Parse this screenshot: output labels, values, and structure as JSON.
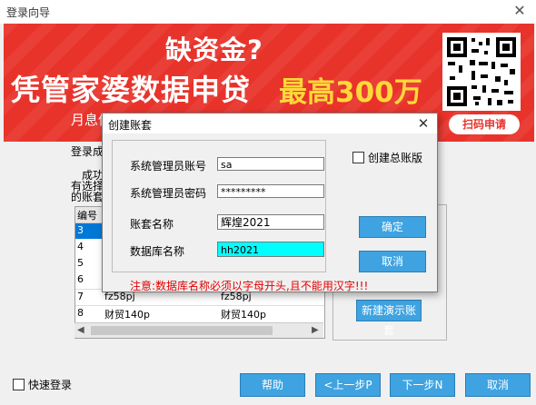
{
  "window": {
    "title": "登录向导",
    "close_glyph": "✕"
  },
  "banner": {
    "question": "缺资金?",
    "main": "凭管家婆数据申贷",
    "max": "最高300万",
    "sub": "月息低",
    "scan": "扫码申请",
    "accent": "#e8332b"
  },
  "background": {
    "line1": "登录成",
    "line2": "成功",
    "line3": "有选择",
    "line4": "的账套",
    "grid_header": {
      "col1": "编号"
    },
    "rows": [
      {
        "id": "3",
        "name": "",
        "name2": ""
      },
      {
        "id": "4",
        "name": "",
        "name2": ""
      },
      {
        "id": "5",
        "name": "",
        "name2": ""
      },
      {
        "id": "6",
        "name": "",
        "name2": ""
      },
      {
        "id": "7",
        "name": "fz58pj",
        "name2": "fz58pj"
      },
      {
        "id": "8",
        "name": "财贸140p",
        "name2": "财贸140p"
      }
    ],
    "new_demo": "新建演示账套"
  },
  "footer": {
    "quick_login": "快速登录",
    "help": "帮助",
    "prev": "<上一步P",
    "next": "下一步N",
    "cancel": "取消"
  },
  "dialog": {
    "title": "创建账套",
    "close_glyph": "✕",
    "fields": {
      "admin_account_label": "系统管理员账号",
      "admin_account_value": "sa",
      "admin_password_label": "系统管理员密码",
      "admin_password_value": "*********",
      "set_name_label": "账套名称",
      "set_name_value": "辉煌2021",
      "db_name_label": "数据库名称",
      "db_name_value": "hh2021"
    },
    "create_general": "创建总账版",
    "confirm": "确定",
    "cancel": "取消",
    "note": "注意:数据库名称必须以字母开头,且不能用汉字!!!"
  }
}
